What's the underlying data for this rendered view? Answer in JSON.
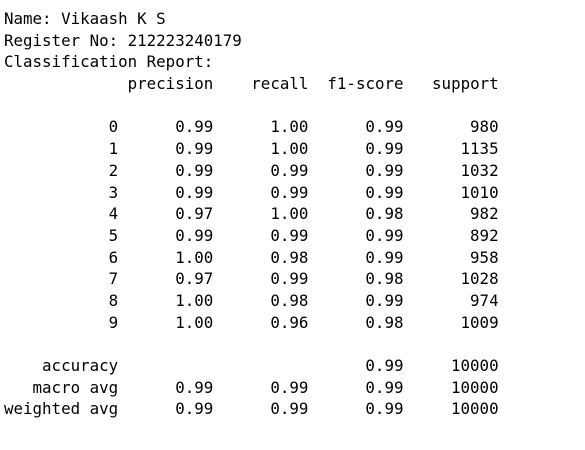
{
  "header": {
    "name_line": "Name: Vikaash K S",
    "register_line": "Register No: 212223240179",
    "report_title": "Classification Report:"
  },
  "report": {
    "columns": [
      "precision",
      "recall",
      "f1-score",
      "support"
    ],
    "rows": [
      {
        "label": "0",
        "precision": "0.99",
        "recall": "1.00",
        "f1": "0.99",
        "support": "980"
      },
      {
        "label": "1",
        "precision": "0.99",
        "recall": "1.00",
        "f1": "0.99",
        "support": "1135"
      },
      {
        "label": "2",
        "precision": "0.99",
        "recall": "0.99",
        "f1": "0.99",
        "support": "1032"
      },
      {
        "label": "3",
        "precision": "0.99",
        "recall": "0.99",
        "f1": "0.99",
        "support": "1010"
      },
      {
        "label": "4",
        "precision": "0.97",
        "recall": "1.00",
        "f1": "0.98",
        "support": "982"
      },
      {
        "label": "5",
        "precision": "0.99",
        "recall": "0.99",
        "f1": "0.99",
        "support": "892"
      },
      {
        "label": "6",
        "precision": "1.00",
        "recall": "0.98",
        "f1": "0.99",
        "support": "958"
      },
      {
        "label": "7",
        "precision": "0.97",
        "recall": "0.99",
        "f1": "0.98",
        "support": "1028"
      },
      {
        "label": "8",
        "precision": "1.00",
        "recall": "0.98",
        "f1": "0.99",
        "support": "974"
      },
      {
        "label": "9",
        "precision": "1.00",
        "recall": "0.96",
        "f1": "0.98",
        "support": "1009"
      }
    ],
    "summary": [
      {
        "label": "accuracy",
        "precision": "",
        "recall": "",
        "f1": "0.99",
        "support": "10000"
      },
      {
        "label": "macro avg",
        "precision": "0.99",
        "recall": "0.99",
        "f1": "0.99",
        "support": "10000"
      },
      {
        "label": "weighted avg",
        "precision": "0.99",
        "recall": "0.99",
        "f1": "0.99",
        "support": "10000"
      }
    ]
  },
  "colors": {
    "text": "#000000",
    "background": "#ffffff"
  }
}
